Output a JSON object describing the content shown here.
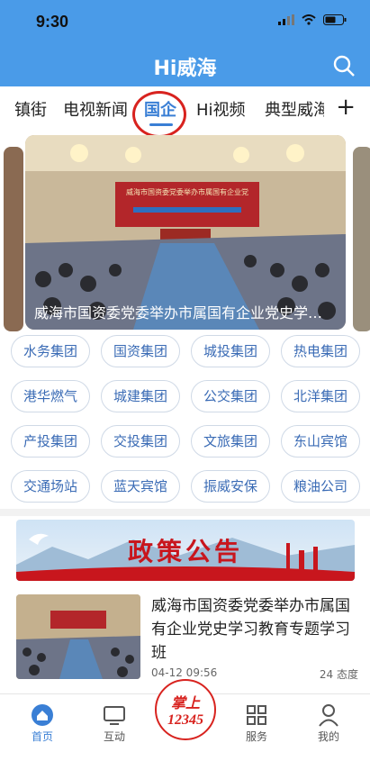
{
  "status": {
    "time": "9:30"
  },
  "header": {
    "title": "Hi威海"
  },
  "tabs": [
    {
      "label": "镇街"
    },
    {
      "label": "电视新闻"
    },
    {
      "label": "国企"
    },
    {
      "label": "Hi视频"
    },
    {
      "label": "典型威海"
    }
  ],
  "tab_more": "+",
  "banner": {
    "caption": "威海市国资委党委举办市属国有企业党史学习教育专题学习班"
  },
  "banner_photo_text": "威海市国资委党委举办市属国有企业党史学习教育专题学习班",
  "groups": [
    "水务集团",
    "国资集团",
    "城投集团",
    "热电集团",
    "港华燃气",
    "城建集团",
    "公交集团",
    "北洋集团",
    "产投集团",
    "交投集团",
    "文旅集团",
    "东山宾馆",
    "交通场站",
    "蓝天宾馆",
    "振威安保",
    "粮油公司"
  ],
  "policy": {
    "title": "政策公告"
  },
  "news": {
    "title": "威海市国资委党委举办市属国有企业党史学习教育专题学习班",
    "date": "04-12 09:56",
    "rating": "24 态度"
  },
  "bottom_nav": [
    {
      "label": "首页",
      "icon": "home-icon"
    },
    {
      "label": "互动",
      "icon": "tv-icon"
    },
    {
      "label": "服务",
      "icon": "grid-icon"
    },
    {
      "label": "我的",
      "icon": "user-icon"
    }
  ],
  "center_logo": {
    "line1": "掌上",
    "line2": "12345"
  },
  "colors": {
    "brand": "#4a9be8",
    "accent": "#3a7fd5",
    "highlight": "#d8231f"
  }
}
